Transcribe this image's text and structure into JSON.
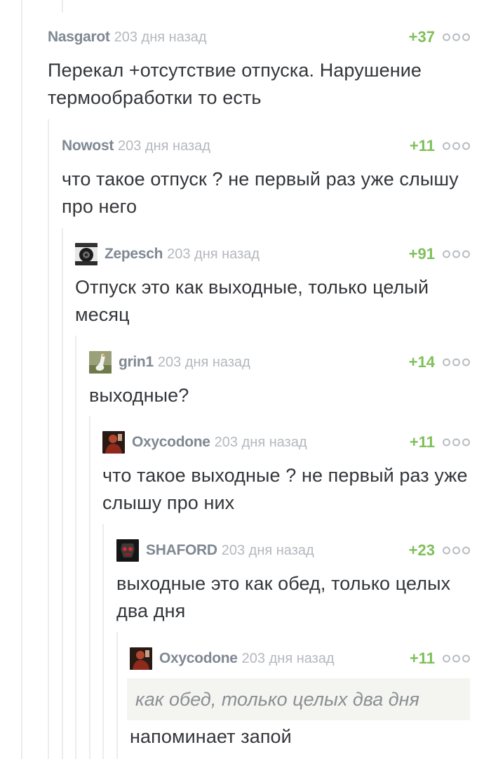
{
  "comments": [
    {
      "author": "Nasgarot",
      "time": "203 дня назад",
      "rating": "+37",
      "avatar": "",
      "text": "Перекал +отсутствие отпуска. Нарушение термообработки то есть"
    },
    {
      "author": "Nowost",
      "time": "203 дня назад",
      "rating": "+11",
      "avatar": "",
      "text": "что такое отпуск ? не первый раз уже слышу про него"
    },
    {
      "author": "Zepesch",
      "time": "203 дня назад",
      "rating": "+91",
      "avatar": "avatar-dark-figure-icon",
      "text": "Отпуск это как выходные, только целый месяц"
    },
    {
      "author": "grin1",
      "time": "203 дня назад",
      "rating": "+14",
      "avatar": "avatar-goose-icon",
      "text": "выходные?"
    },
    {
      "author": "Oxycodone",
      "time": "203 дня назад",
      "rating": "+11",
      "avatar": "avatar-red-figure-icon",
      "text": "что такое выходные ? не первый раз уже слышу про них"
    },
    {
      "author": "SHAFORD",
      "time": "203 дня назад",
      "rating": "+23",
      "avatar": "avatar-red-robot-icon",
      "text": "выходные это как обед, только целых два дня"
    },
    {
      "author": "Oxycodone",
      "time": "203 дня назад",
      "rating": "+11",
      "avatar": "avatar-red-figure-icon",
      "quote": "как обед, только целых два дня",
      "text": "напоминает запой"
    }
  ],
  "colors": {
    "author": "#7f8893",
    "time": "#b4b8bd",
    "rating": "#7fbf5a",
    "text": "#33363a",
    "thread_line": "#ececec",
    "quote_bg": "#f4f5f1"
  }
}
